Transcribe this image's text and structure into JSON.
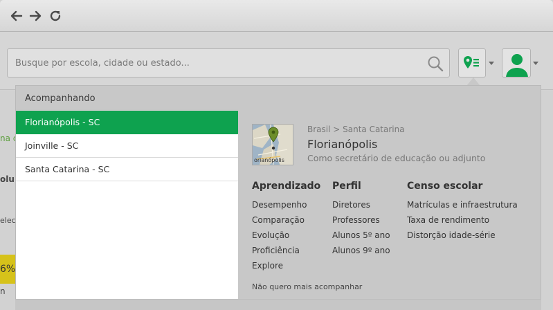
{
  "nav": {
    "back_icon": "arrow-left-icon",
    "forward_icon": "arrow-right-icon",
    "reload_icon": "reload-icon"
  },
  "search": {
    "placeholder": "Busque por escola, cidade ou estado...",
    "value": ""
  },
  "header": {
    "location_icon": "map-pin-list-icon",
    "user_icon": "user-silhouette-icon"
  },
  "background_fragments": [
    "na c",
    "olu",
    "elec",
    "6%",
    "n"
  ],
  "following": {
    "title": "Acompanhando",
    "items": [
      {
        "label": "Florianópolis - SC",
        "active": true
      },
      {
        "label": "Joinville - SC",
        "active": false
      },
      {
        "label": "Santa Catarina - SC",
        "active": false
      }
    ]
  },
  "detail": {
    "breadcrumb": "Brasil > Santa Catarina",
    "city": "Florianópolis",
    "role": "Como secretário de educação ou adjunto",
    "map_label": "orianópolis",
    "columns": [
      {
        "title": "Aprendizado",
        "links": [
          "Desempenho",
          "Comparação",
          "Evolução",
          "Proficiência",
          "Explore"
        ]
      },
      {
        "title": "Perfil",
        "links": [
          "Diretores",
          "Professores",
          "Alunos 5º ano",
          "Alunos 9º ano"
        ]
      },
      {
        "title": "Censo escolar",
        "links": [
          "Matrículas e infraestrutura",
          "Taxa de rendimento",
          "Distorção idade-série"
        ]
      }
    ],
    "unfollow": "Não quero mais acompanhar"
  },
  "colors": {
    "accent": "#0ea24f",
    "overlay": "#c8c8c8"
  }
}
